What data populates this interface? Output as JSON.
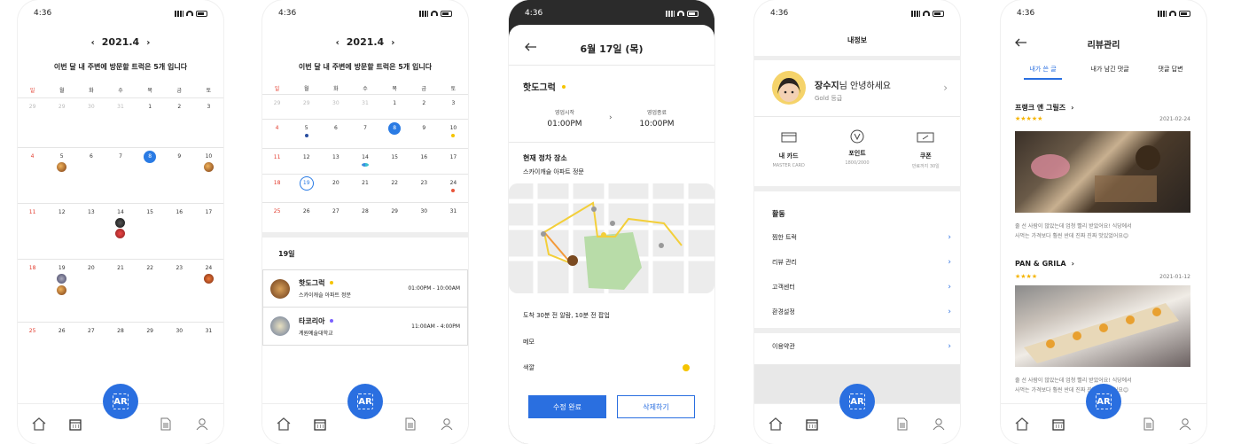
{
  "status": {
    "time": "4:36"
  },
  "calendar": {
    "month": "2021.4",
    "prev": "‹",
    "next": "›",
    "subtitle": "이번 달 내 주변에 방문할 트럭은 5개 입니다",
    "weekdays": [
      "일",
      "월",
      "화",
      "수",
      "목",
      "금",
      "토"
    ],
    "weeks": [
      [
        "29",
        "29",
        "30",
        "31",
        "1",
        "2",
        "3"
      ],
      [
        "4",
        "5",
        "6",
        "7",
        "8",
        "9",
        "10"
      ],
      [
        "11",
        "12",
        "13",
        "14",
        "15",
        "16",
        "17"
      ],
      [
        "18",
        "19",
        "20",
        "21",
        "22",
        "23",
        "24"
      ],
      [
        "25",
        "26",
        "27",
        "28",
        "29",
        "30",
        "31"
      ]
    ]
  },
  "day_list": {
    "heading": "19일",
    "items": [
      {
        "name": "핫도그럭",
        "sub": "스카이캐슬 아파트 정문",
        "time": "01:00PM - 10:00AM",
        "dot": "#f5c400"
      },
      {
        "name": "타코리아",
        "sub": "계원예술대학교",
        "time": "11:00AM - 4:00PM",
        "dot": "#7b61ff"
      }
    ]
  },
  "edit": {
    "title": "6월 17일 (목)",
    "truck": "핫도그럭",
    "start_label": "영업시작",
    "start": "01:00PM",
    "end_label": "영업종료",
    "end": "10:00PM",
    "loc_title": "현재 정차 장소",
    "loc": "스카이캐슬 아파트 정문",
    "alarm": "도착 30분 전 알람, 10분 전 팝업",
    "memo": "메모",
    "color_label": "색깔",
    "color": "#f5c400",
    "save": "수정 완료",
    "delete": "삭제하기"
  },
  "myinfo": {
    "title": "내정보",
    "user": "장수지",
    "greet": "님 안녕하세요",
    "grade": "Gold 등급",
    "stats": [
      {
        "label": "내 카드",
        "sub": "MASTER CARD",
        "icon": "card-icon"
      },
      {
        "label": "포인트",
        "sub": "1800/2000",
        "icon": "point-icon"
      },
      {
        "label": "쿠폰",
        "sub": "만료까지 30일",
        "icon": "coupon-icon"
      }
    ],
    "section": "활동",
    "menu": [
      "찜한 트럭",
      "리뷰 관리",
      "고객센터",
      "환경설정"
    ],
    "terms": "이용약관"
  },
  "reviews": {
    "title": "리뷰관리",
    "tabs": [
      "내가 쓴 글",
      "내가 남긴 댓글",
      "댓글 답변"
    ],
    "items": [
      {
        "name": "프랭크 앤 그릴즈",
        "stars": "★★★★★",
        "date": "2021-02-24",
        "text1": "줄 선 사람이 많았는데 엄청 빨리 받았어요! 식당에서",
        "text2": "사먹는 가격보다 훨씬 싼데 진짜 진짜 맛있었어요😊"
      },
      {
        "name": "PAN & GRILA",
        "stars": "★★★★",
        "date": "2021-01-12",
        "text1": "줄 선 사람이 많았는데 엄청 빨리 받았어요! 식당에서",
        "text2": "사먹는 가격보다 훨씬 싼데 진짜 진짜 맛있었어요😊"
      }
    ]
  },
  "ar_label": "AR",
  "colors": {
    "accent": "#2a6fe0",
    "sunday": "#e23a2c",
    "star": "#f5b400"
  }
}
